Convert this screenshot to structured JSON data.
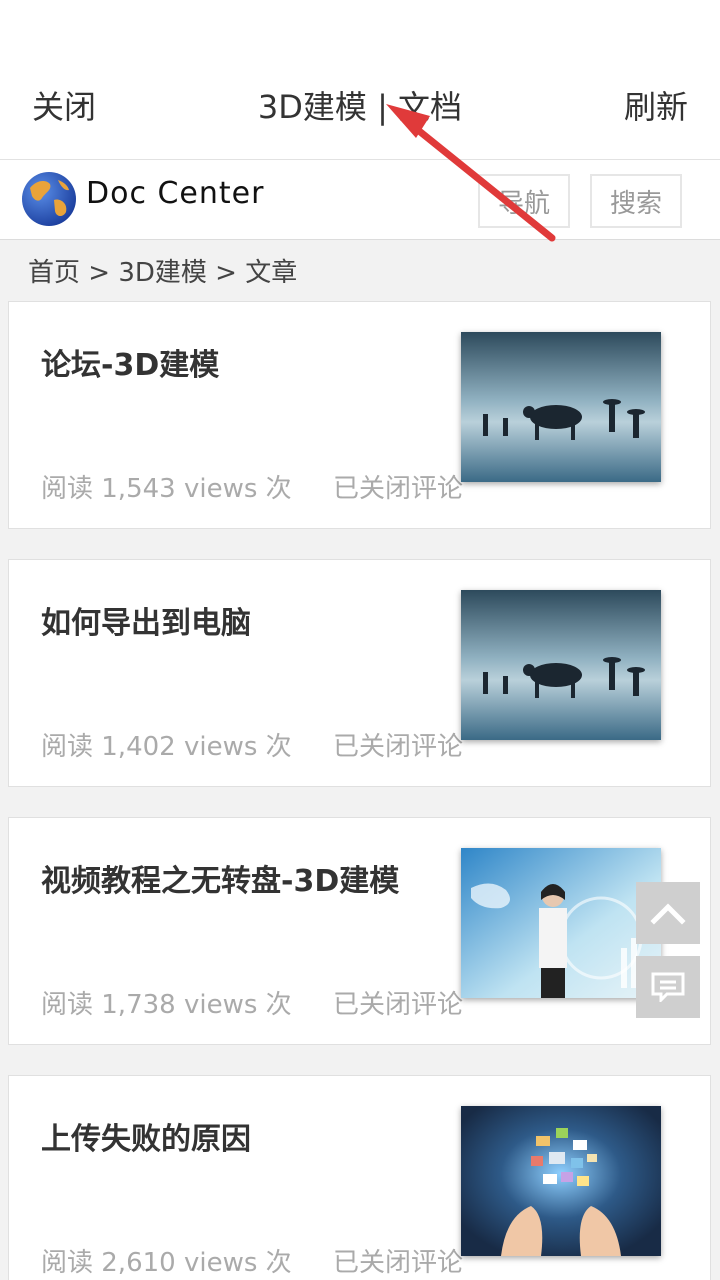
{
  "titlebar": {
    "close_label": "关闭",
    "title": "3D建模 | 文档",
    "refresh_label": "刷新"
  },
  "site": {
    "logo_text": "Doc Center",
    "nav_label": "导航",
    "search_label": "搜索"
  },
  "breadcrumb": "首页 > 3D建模 > 文章",
  "articles": [
    {
      "title": "论坛-3D建模",
      "views": "阅读 1,543 views 次",
      "comments": "已关闭评论",
      "thumb": "buffalo-scene"
    },
    {
      "title": "如何导出到电脑",
      "views": "阅读 1,402 views 次",
      "comments": "已关闭评论",
      "thumb": "buffalo-scene"
    },
    {
      "title": "视频教程之无转盘-3D建模",
      "views": "阅读 1,738 views 次",
      "comments": "已关闭评论",
      "thumb": "woman-tech-interface"
    },
    {
      "title": "上传失败的原因",
      "views": "阅读 2,610 views 次",
      "comments": "已关闭评论",
      "thumb": "hands-holding-images"
    }
  ],
  "floating": {
    "top_icon": "chevron-up-icon",
    "comment_icon": "comment-icon"
  },
  "colors": {
    "annotation_arrow": "#e03a3a",
    "float_button": "#cfcfcf"
  }
}
